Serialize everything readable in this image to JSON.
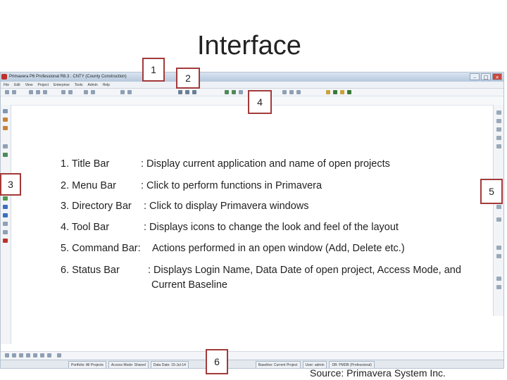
{
  "slide": {
    "title": "Interface",
    "source": "Source: Primavera System Inc."
  },
  "window": {
    "title_text": "Primavera P6 Professional R8.3 : CNTY (County Construction)",
    "controls": {
      "minimize": "–",
      "maximize": "□",
      "close": "×"
    },
    "menu_items": [
      "File",
      "Edit",
      "View",
      "Project",
      "Enterprise",
      "Tools",
      "Admin",
      "Help"
    ],
    "status_cells": [
      "Portfolio: All Projects",
      "Access Mode: Shared",
      "Data Date: 15-Jul-14",
      "Baseline: Current Project",
      "User: admin",
      "DB: PMDB (Professional)"
    ]
  },
  "callouts": [
    "1",
    "2",
    "3",
    "4",
    "5",
    "6"
  ],
  "legend": [
    {
      "term": "1. Title Bar",
      "desc": ": Display current application and name of open projects"
    },
    {
      "term": "2. Menu Bar",
      "desc": ": Click to perform functions in Primavera"
    },
    {
      "term": "3. Directory Bar",
      "desc": ": Click to display Primavera windows"
    },
    {
      "term": "4. Tool Bar",
      "desc": ": Displays icons to change the look and feel of the layout"
    },
    {
      "term": "5. Command Bar:",
      "desc": "Actions performed in an open window (Add, Delete etc.)"
    },
    {
      "term": "6. Status Bar",
      "desc": ": Displays Login Name, Data Date of open project, Access Mode, and",
      "desc2": "Current Baseline"
    }
  ],
  "colors": {
    "callout_border": "#a33a3a",
    "titlebar": "#b6c8dd"
  }
}
